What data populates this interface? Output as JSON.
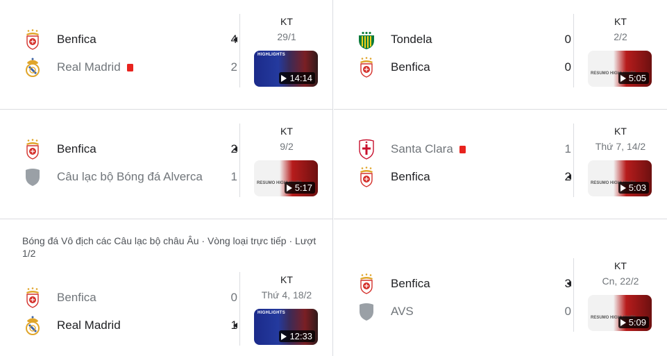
{
  "matches": [
    {
      "competition": "",
      "home": {
        "name": "Benfica",
        "score": "4",
        "red_card": false,
        "winner": true
      },
      "away": {
        "name": "Real Madrid",
        "score": "2",
        "red_card": true,
        "winner": false
      },
      "status": "KT",
      "date": "29/1",
      "thumb_style": "highlights",
      "thumb_label": "HIGHLIGHTS",
      "duration": "14:14"
    },
    {
      "competition": "",
      "home": {
        "name": "Tondela",
        "score": "0",
        "red_card": false,
        "winner": false
      },
      "away": {
        "name": "Benfica",
        "score": "0",
        "red_card": false,
        "winner": false
      },
      "status": "KT",
      "date": "2/2",
      "thumb_style": "resumo",
      "thumb_label": "RESUMO HIGHLIGHTS",
      "duration": "5:05"
    },
    {
      "competition": "",
      "home": {
        "name": "Benfica",
        "score": "2",
        "red_card": false,
        "winner": true
      },
      "away": {
        "name": "Câu lạc bộ Bóng đá Alverca",
        "score": "1",
        "red_card": false,
        "winner": false
      },
      "status": "KT",
      "date": "9/2",
      "thumb_style": "resumo",
      "thumb_label": "RESUMO HIGHLIGHTS",
      "duration": "5:17"
    },
    {
      "competition": "",
      "home": {
        "name": "Santa Clara",
        "score": "1",
        "red_card": true,
        "winner": false
      },
      "away": {
        "name": "Benfica",
        "score": "2",
        "red_card": false,
        "winner": true
      },
      "status": "KT",
      "date": "Thứ 7, 14/2",
      "thumb_style": "resumo",
      "thumb_label": "RESUMO HIGHLIGHTS",
      "duration": "5:03"
    },
    {
      "competition": "Bóng đá Vô địch các Câu lạc bộ châu Âu · Vòng loại trực tiếp · Lượt 1/2",
      "home": {
        "name": "Benfica",
        "score": "0",
        "red_card": false,
        "winner": false
      },
      "away": {
        "name": "Real Madrid",
        "score": "1",
        "red_card": false,
        "winner": true
      },
      "status": "KT",
      "date": "Thứ 4, 18/2",
      "thumb_style": "highlights",
      "thumb_label": "HIGHLIGHTS",
      "duration": "12:33"
    },
    {
      "competition": "",
      "home": {
        "name": "Benfica",
        "score": "3",
        "red_card": false,
        "winner": true
      },
      "away": {
        "name": "AVS",
        "score": "0",
        "red_card": false,
        "winner": false
      },
      "status": "KT",
      "date": "Cn, 22/2",
      "thumb_style": "resumo",
      "thumb_label": "RESUMO HIGHLIGHTS",
      "duration": "5:09"
    }
  ],
  "crest_icons": {
    "Benfica": "benfica-crest-icon",
    "Real Madrid": "real-madrid-crest-icon",
    "Tondela": "tondela-crest-icon",
    "Santa Clara": "santa-clara-crest-icon",
    "Câu lạc bộ Bóng đá Alverca": "generic-shield-icon",
    "AVS": "generic-shield-icon"
  },
  "colors": {
    "red_card": "#e8231e",
    "divider": "#dadce0",
    "loser_text": "#70757a"
  }
}
